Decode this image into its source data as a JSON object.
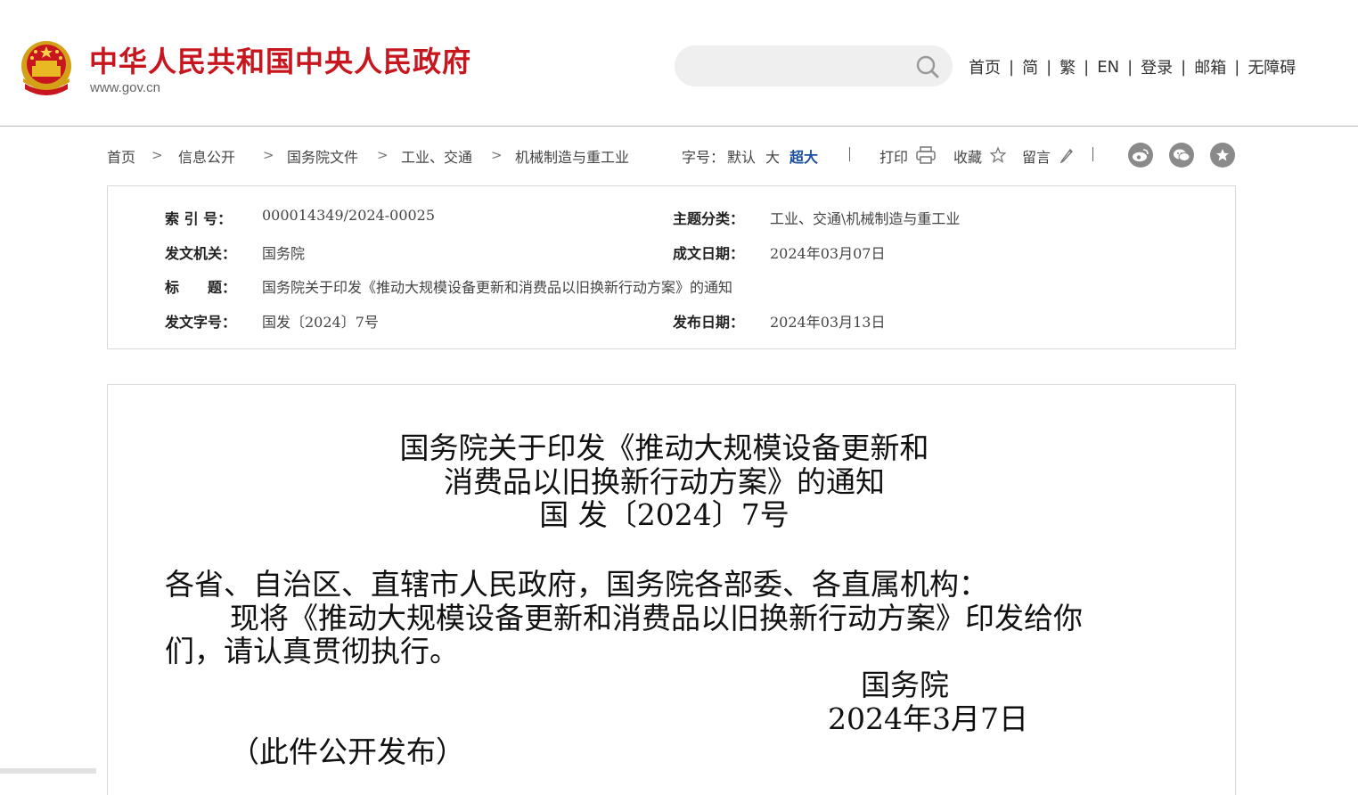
{
  "header": {
    "site_name": "中华人民共和国中央人民政府",
    "site_url": "www.gov.cn",
    "search": {
      "placeholder": "",
      "value": ""
    },
    "nav": [
      "首页",
      "简",
      "繁",
      "EN",
      "登录",
      "邮箱",
      "无障碍"
    ],
    "nav_separator": "|",
    "brand_color": "#c8161e"
  },
  "breadcrumb": [
    "首页",
    "信息公开",
    "国务院文件",
    "工业、交通",
    "机械制造与重工业"
  ],
  "toolbar": {
    "font_size_label": "字号：",
    "font_default": "默认",
    "font_large": "大",
    "font_xlarge": "超大",
    "print": "打印",
    "favorite": "收藏",
    "comment": "留言",
    "share_icons": [
      "weibo-icon",
      "wechat-icon",
      "star-share-icon"
    ]
  },
  "meta": {
    "index_no_label": "索 引 号：",
    "index_no": "000014349/2024-00025",
    "topic_label": "主题分类：",
    "topic": "工业、交通\\机械制造与重工业",
    "issuer_label": "发文机关：",
    "issuer": "国务院",
    "written_date_label": "成文日期：",
    "written_date": "2024年03月07日",
    "title_label": "标　　题：",
    "title": "国务院关于印发《推动大规模设备更新和消费品以旧换新行动方案》的通知",
    "doc_no_label": "发文字号：",
    "doc_no": "国发〔2024〕7号",
    "publish_date_label": "发布日期：",
    "publish_date": "2024年03月13日"
  },
  "article": {
    "title_line1": "国务院关于印发《推动大规模设备更新和",
    "title_line2": "消费品以旧换新行动方案》的通知",
    "doc_no": "国 发〔2024〕7号",
    "salutation": "各省、自治区、直辖市人民政府，国务院各部委、各直属机构：",
    "body_line1": "现将《推动大规模设备更新和消费品以旧换新行动方案》印发给你",
    "body_line2": "们，请认真贯彻执行。",
    "signer": "国务院",
    "date": "2024年3月7日",
    "note": "（此件公开发布）"
  }
}
